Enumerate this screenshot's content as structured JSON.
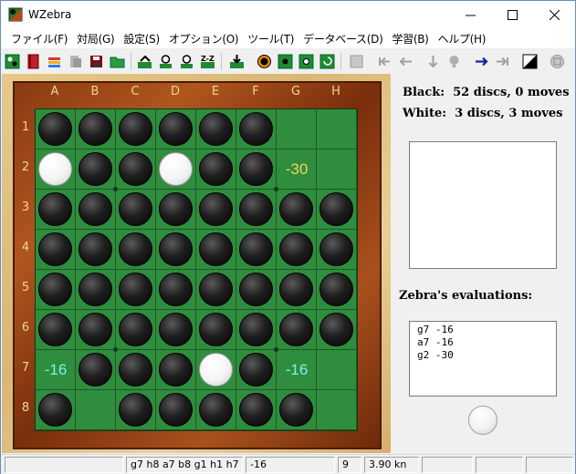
{
  "window": {
    "title": "WZebra"
  },
  "menu": [
    "ファイル(F)",
    "対局(G)",
    "設定(S)",
    "オプション(O)",
    "ツール(T)",
    "データベース(D)",
    "学習(B)",
    "ヘルプ(H)"
  ],
  "toolbar": {
    "buttons": [
      "new-game-icon",
      "open-book-icon",
      "open-file-icon",
      "print-icon",
      "save-icon",
      "folder-icon",
      "arrow-forward-icon",
      "user-play-icon",
      "user-play-2-icon",
      "zz-icon",
      "download-icon",
      "stop-icon",
      "board-icon",
      "board-2-icon",
      "rotate-icon",
      "setup-icon",
      "first-move-icon",
      "back-icon",
      "down-icon",
      "hint-icon",
      "forward-icon",
      "last-move-icon",
      "contrast-icon",
      "coin-icon"
    ]
  },
  "board": {
    "columns": [
      "A",
      "B",
      "C",
      "D",
      "E",
      "F",
      "G",
      "H"
    ],
    "rows": [
      "1",
      "2",
      "3",
      "4",
      "5",
      "6",
      "7",
      "8"
    ],
    "cells": [
      [
        "B",
        "B",
        "B",
        "B",
        "B",
        "B",
        "",
        ""
      ],
      [
        "W",
        "B",
        "B",
        "W",
        "B",
        "B",
        "",
        ""
      ],
      [
        "B",
        "B",
        "B",
        "B",
        "B",
        "B",
        "B",
        "B"
      ],
      [
        "B",
        "B",
        "B",
        "B",
        "B",
        "B",
        "B",
        "B"
      ],
      [
        "B",
        "B",
        "B",
        "B",
        "B",
        "B",
        "B",
        "B"
      ],
      [
        "B",
        "B",
        "B",
        "B",
        "B",
        "B",
        "B",
        "B"
      ],
      [
        "",
        "B",
        "B",
        "B",
        "W",
        "B",
        "",
        ""
      ],
      [
        "B",
        "",
        "B",
        "B",
        "B",
        "B",
        "B",
        ""
      ]
    ],
    "evaluations": [
      {
        "row": 2,
        "col": 7,
        "text": "-30",
        "color": "#f4d35e"
      },
      {
        "row": 7,
        "col": 1,
        "text": "-16",
        "color": "#7ff0e6"
      },
      {
        "row": 7,
        "col": 7,
        "text": "-16",
        "color": "#7ff0e6"
      }
    ]
  },
  "panel": {
    "black_status": "Black:  52 discs, 0 moves",
    "white_status": "White:  3 discs, 3 moves",
    "evaluations_title": "Zebra's evaluations:",
    "evaluations": [
      "g7 -16",
      "a7 -16",
      "g2 -30"
    ],
    "side_to_move": "white"
  },
  "status": {
    "moves": "g7 h8 a7 b8 g1 h1 h7 g2",
    "score": "-16",
    "depth": "9",
    "speed": "3.90 kn"
  }
}
